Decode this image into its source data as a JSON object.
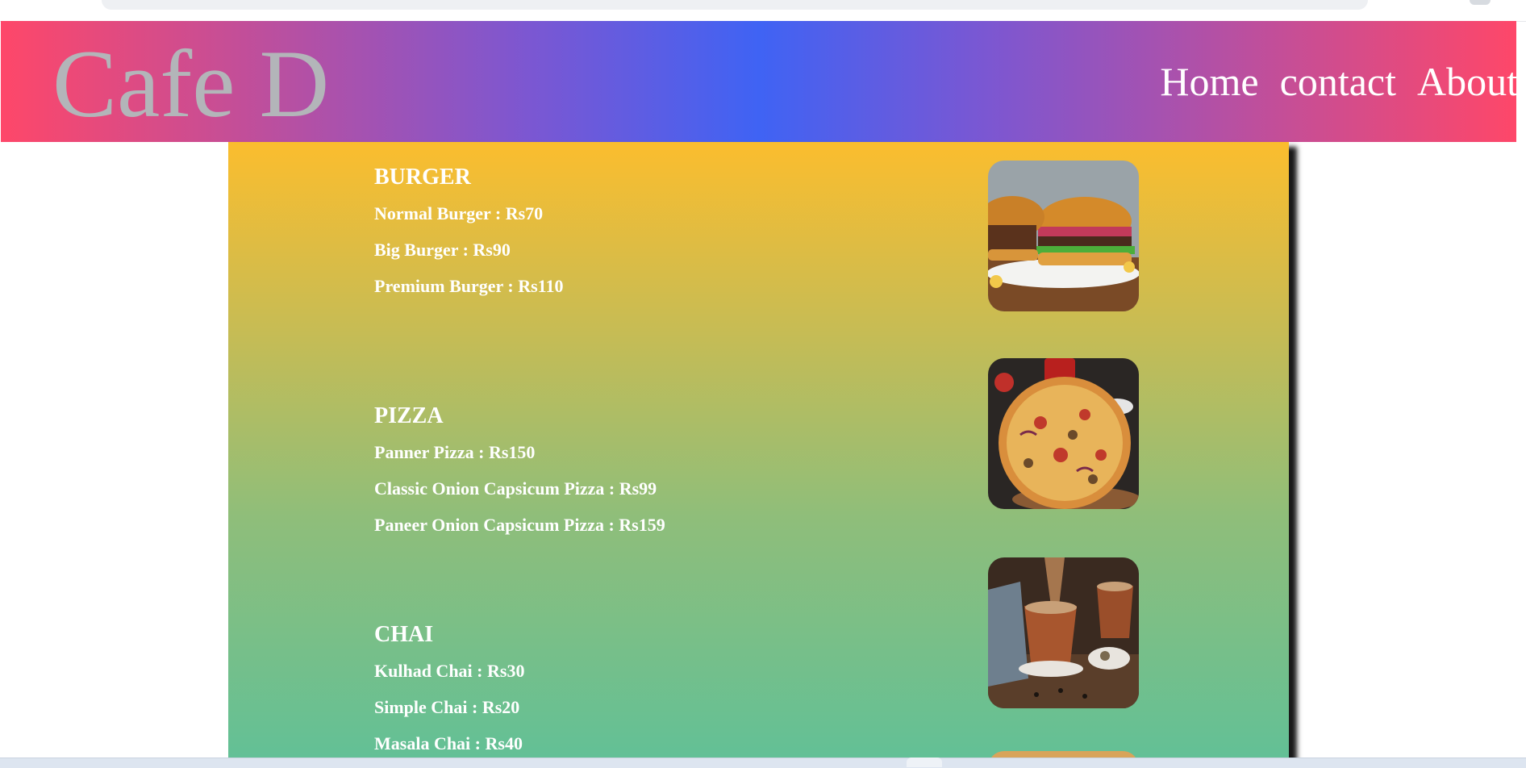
{
  "brand": {
    "name": "Cafe D"
  },
  "nav": {
    "items": [
      {
        "label": "Home"
      },
      {
        "label": "contact"
      },
      {
        "label": "About"
      }
    ]
  },
  "colors": {
    "nav_gradient_edge": "#fe4769",
    "nav_gradient_center": "#3f63f4",
    "panel_gradient_top": "#fbbd2e",
    "panel_gradient_bottom": "#61c097",
    "brand_text": "#b3b5b9"
  },
  "menu": {
    "sections": [
      {
        "title": "BURGER",
        "image_icon": "burger-photo",
        "items": [
          {
            "label": "Normal Burger : Rs70"
          },
          {
            "label": "Big Burger : Rs90"
          },
          {
            "label": "Premium Burger : Rs110"
          }
        ]
      },
      {
        "title": "PIZZA",
        "image_icon": "pizza-photo",
        "items": [
          {
            "label": "Panner Pizza : Rs150"
          },
          {
            "label": "Classic Onion Capsicum Pizza : Rs99"
          },
          {
            "label": "Paneer Onion Capsicum Pizza : Rs159"
          }
        ]
      },
      {
        "title": "CHAI",
        "image_icon": "chai-photo",
        "items": [
          {
            "label": "Kulhad Chai : Rs30"
          },
          {
            "label": "Simple Chai : Rs20"
          },
          {
            "label": "Masala Chai : Rs40"
          }
        ]
      }
    ]
  }
}
